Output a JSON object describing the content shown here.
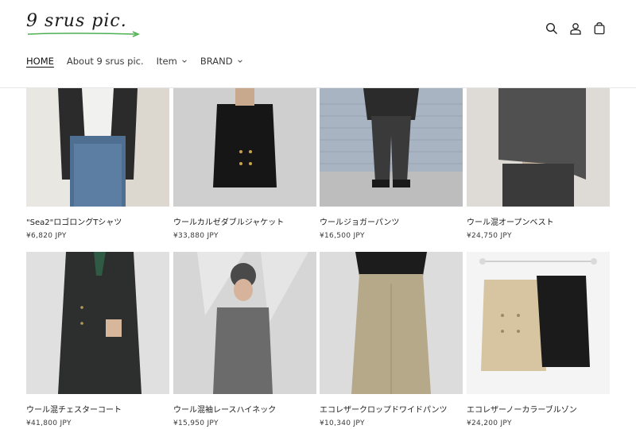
{
  "brand": {
    "logo_text": "9 srus pic.",
    "accent": "#4caf50"
  },
  "header": {
    "icons": [
      "search-icon",
      "account-icon",
      "cart-icon"
    ]
  },
  "nav": {
    "items": [
      {
        "label": "HOME",
        "active": true,
        "has_dropdown": false
      },
      {
        "label": "About 9 srus pic.",
        "active": false,
        "has_dropdown": false
      },
      {
        "label": "Item",
        "active": false,
        "has_dropdown": true
      },
      {
        "label": "BRAND",
        "active": false,
        "has_dropdown": true
      }
    ]
  },
  "products": [
    {
      "title": "\"Sea2\"ロゴロングTシャツ",
      "price": "¥6,820 JPY"
    },
    {
      "title": "ウールカルゼダブルジャケット",
      "price": "¥33,880 JPY"
    },
    {
      "title": "ウールジョガーパンツ",
      "price": "¥16,500 JPY"
    },
    {
      "title": "ウール混オープンベスト",
      "price": "¥24,750 JPY"
    },
    {
      "title": "ウール混チェスターコート",
      "price": "¥41,800 JPY"
    },
    {
      "title": "ウール混袖レースハイネック",
      "price": "¥15,950 JPY"
    },
    {
      "title": "エコレザークロップドワイドパンツ",
      "price": "¥10,340 JPY"
    },
    {
      "title": "エコレザーノーカラーブルゾン",
      "price": "¥24,200 JPY"
    }
  ]
}
